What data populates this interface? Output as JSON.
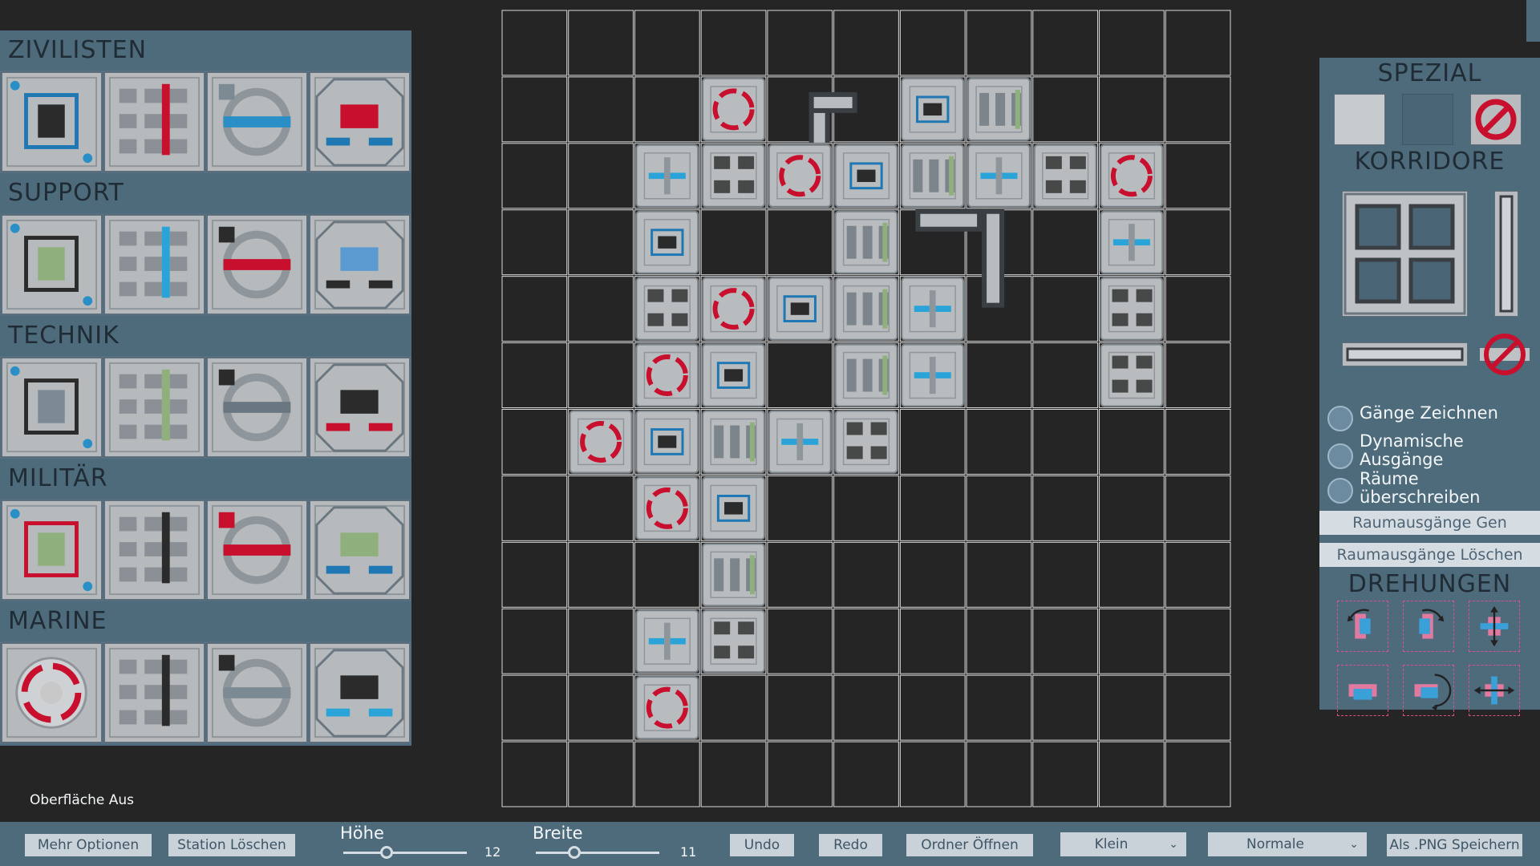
{
  "palette": {
    "categories": [
      {
        "name": "ZIVILISTEN",
        "rooms": [
          "hangar-blue",
          "office-red",
          "lounge",
          "medbay-red"
        ]
      },
      {
        "name": "SUPPORT",
        "rooms": [
          "quarters",
          "water-tanks",
          "lab",
          "cargo-bay"
        ]
      },
      {
        "name": "TECHNIK",
        "rooms": [
          "engine",
          "fan-room",
          "reactor-ring",
          "meeting-room"
        ]
      },
      {
        "name": "MILITÄR",
        "rooms": [
          "barracks",
          "armory",
          "prison-red",
          "training"
        ]
      },
      {
        "name": "MARINE",
        "rooms": [
          "landing-pad",
          "briefing",
          "hallway-x",
          "command"
        ]
      }
    ]
  },
  "right_panel": {
    "spezial_title": "SPEZIAL",
    "korridore_title": "KORRIDORE",
    "options": [
      {
        "label": "Gänge Zeichnen"
      },
      {
        "label": "Dynamische Ausgänge"
      },
      {
        "label": "Räume überschreiben"
      }
    ],
    "gen_exits_button": "Raumausgänge Gen",
    "delete_exits_button": "Raumausgänge Löschen",
    "drehungen_title": "DREHUNGEN"
  },
  "surface_label": "Oberfläche Aus",
  "bottom_bar": {
    "more_options": "Mehr Optionen",
    "delete_station": "Station Löschen",
    "height_label": "Höhe",
    "height_value": "12",
    "width_label": "Breite",
    "width_value": "11",
    "undo": "Undo",
    "redo": "Redo",
    "open_folder": "Ordner Öffnen",
    "size_select": "Klein",
    "mode_select": "Normale",
    "save_png": "Als .PNG Speichern"
  },
  "grid": {
    "columns": 11,
    "rows": 12,
    "placed_rooms": [
      [
        1,
        3
      ],
      [
        1,
        6
      ],
      [
        1,
        7
      ],
      [
        2,
        2
      ],
      [
        2,
        3
      ],
      [
        2,
        4
      ],
      [
        2,
        5
      ],
      [
        2,
        6
      ],
      [
        2,
        7
      ],
      [
        2,
        8
      ],
      [
        2,
        9
      ],
      [
        3,
        2
      ],
      [
        3,
        5
      ],
      [
        3,
        9
      ],
      [
        4,
        2
      ],
      [
        4,
        3
      ],
      [
        4,
        4
      ],
      [
        4,
        5
      ],
      [
        4,
        6
      ],
      [
        4,
        9
      ],
      [
        5,
        2
      ],
      [
        5,
        3
      ],
      [
        5,
        5
      ],
      [
        5,
        6
      ],
      [
        5,
        9
      ],
      [
        6,
        1
      ],
      [
        6,
        2
      ],
      [
        6,
        3
      ],
      [
        6,
        4
      ],
      [
        6,
        5
      ],
      [
        7,
        2
      ],
      [
        7,
        3
      ],
      [
        8,
        3
      ],
      [
        9,
        2
      ],
      [
        9,
        3
      ],
      [
        10,
        2
      ]
    ]
  }
}
